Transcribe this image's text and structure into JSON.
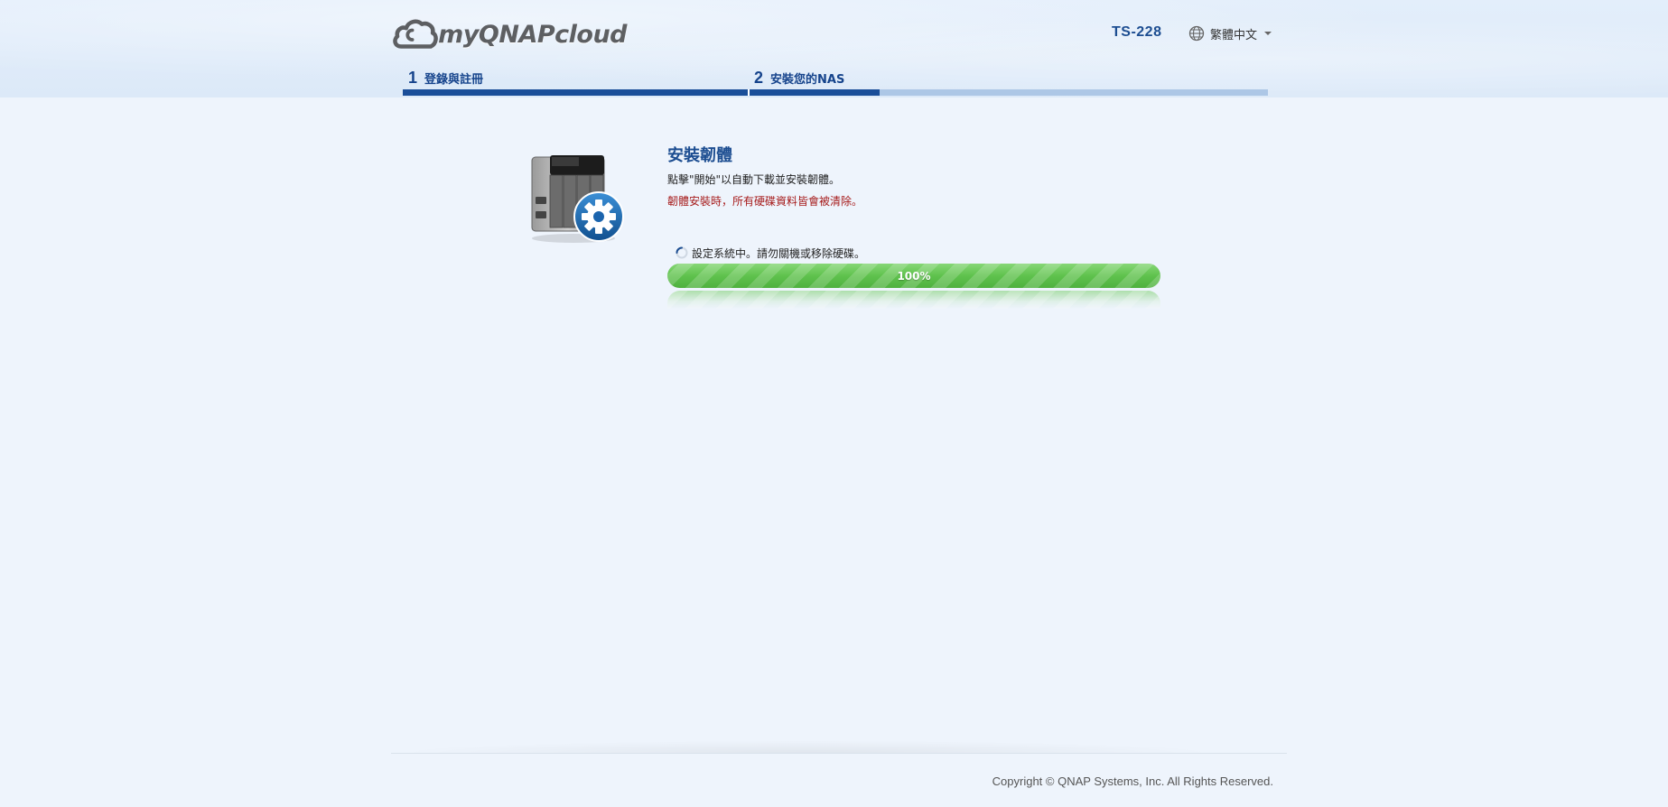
{
  "header": {
    "logo_text": "myQNAPcloud",
    "model": "TS-228",
    "language": {
      "selected": "繁體中文",
      "icon": "globe-icon"
    }
  },
  "steps": [
    {
      "number": "1",
      "label": "登錄與註冊"
    },
    {
      "number": "2",
      "label": "安裝您的NAS"
    }
  ],
  "main": {
    "title": "安裝韌體",
    "description": "點擊\"開始\"以自動下載並安裝韌體。",
    "warning": "韌體安裝時，所有硬碟資料皆會被清除。",
    "status_text": "設定系統中。請勿關機或移除硬碟。",
    "progress": {
      "percent": 100,
      "label": "100%"
    }
  },
  "colors": {
    "primary": "#1c4d91",
    "warning": "#a61b1b",
    "progress": "#5fc24d"
  },
  "footer": {
    "copyright": "Copyright © QNAP Systems, Inc. All Rights Reserved."
  }
}
